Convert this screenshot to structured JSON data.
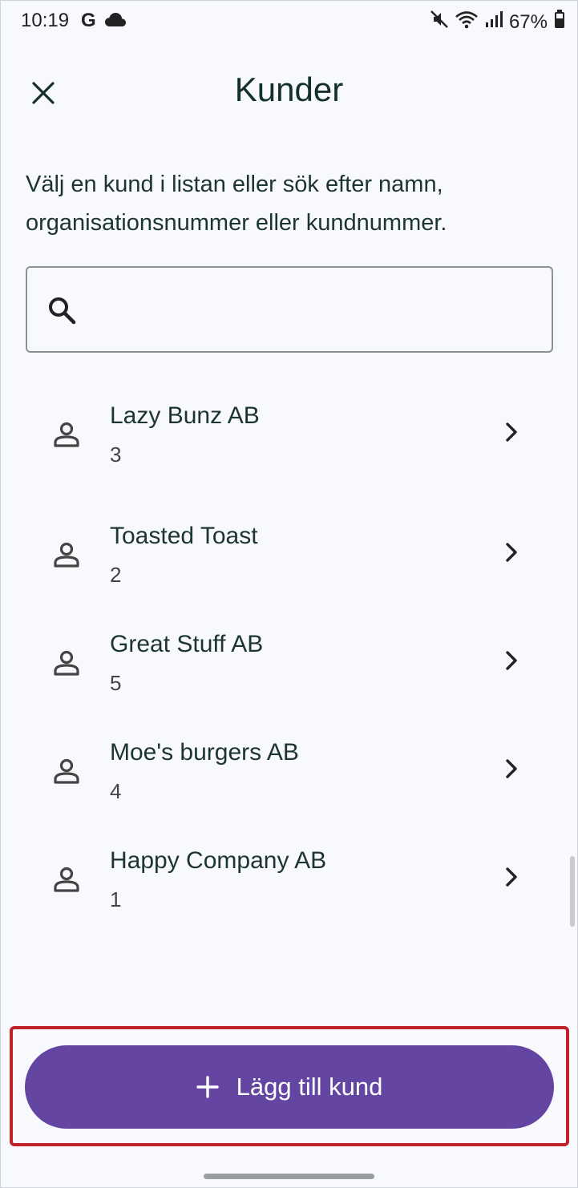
{
  "status_bar": {
    "time": "10:19",
    "google_icon_letter": "G",
    "battery_percent": "67%",
    "icons": [
      "cloud-icon",
      "mute-icon",
      "wifi-icon",
      "signal-icon",
      "battery-icon"
    ]
  },
  "header": {
    "title": "Kunder",
    "close_icon": "close-icon"
  },
  "intro_text": "Välj en kund i listan eller sök efter namn, organisationsnummer eller kundnummer.",
  "search": {
    "value": "",
    "placeholder": "",
    "icon": "search-icon"
  },
  "customers": [
    {
      "name": "Lazy Bunz AB",
      "number": "3"
    },
    {
      "name": "Toasted Toast",
      "number": "2"
    },
    {
      "name": "Great Stuff AB",
      "number": "5"
    },
    {
      "name": "Moe's burgers AB",
      "number": "4"
    },
    {
      "name": "Happy Company AB",
      "number": "1"
    }
  ],
  "add_button": {
    "label": "Lägg till kund",
    "icon": "plus-icon"
  },
  "colors": {
    "accent": "#6446a2",
    "highlight": "#c0202a",
    "background": "#f8f9fd",
    "text": "#13302e"
  }
}
